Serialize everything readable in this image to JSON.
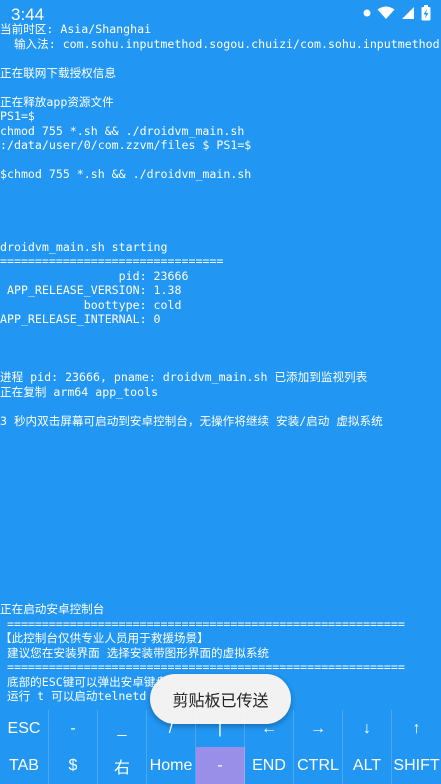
{
  "status_bar": {
    "time": "3:44"
  },
  "terminal": {
    "lines": [
      "当前时区: Asia/Shanghai",
      "  输入法: com.sohu.inputmethod.sogou.chuizi/com.sohu.inputmethod",
      "",
      "正在联网下载授权信息",
      "",
      "正在释放app资源文件",
      "PS1=$",
      "chmod 755 *.sh && ./droidvm_main.sh",
      ":/data/user/0/com.zzvm/files $ PS1=$",
      "",
      "$chmod 755 *.sh && ./droidvm_main.sh",
      "",
      "",
      "",
      "",
      "droidvm_main.sh starting",
      "================================",
      "                 pid: 23666",
      " APP_RELEASE_VERSION: 1.38",
      "            boottype: cold",
      "APP_RELEASE_INTERNAL: 0",
      "",
      "",
      "",
      "进程 pid: 23666, pname: droidvm_main.sh 已添加到监视列表",
      "正在复制 arm64 app_tools",
      "",
      "3 秒内双击屏幕可启动到安卓控制台，无操作将继续 安装/启动 虚拟系统",
      "",
      "",
      "",
      "",
      "",
      "",
      "",
      "",
      "",
      "",
      "",
      "",
      "正在启动安卓控制台",
      " =========================================================",
      "【此控制台仅供专业人员用于救援场景】",
      " 建议您在安装界面 选择安装带图形界面的虚拟系统",
      " =========================================================",
      " 底部的ESC键可以弹出安卓键盘",
      " 运行 t 可以启动telnetd",
      "",
      "$"
    ]
  },
  "toast": {
    "text": "剪贴板已传送"
  },
  "extra_keys": {
    "row1": [
      "ESC",
      "-",
      "_",
      "/",
      "|",
      "←",
      "→",
      "↓",
      "↑"
    ],
    "row2": [
      "TAB",
      "$",
      "右",
      "Home",
      "-",
      "END",
      "CTRL",
      "ALT",
      "SHIFT"
    ]
  },
  "colors": {
    "background": "#2196f3",
    "text": "#ffffff",
    "active_key": "#9a8fe8"
  }
}
